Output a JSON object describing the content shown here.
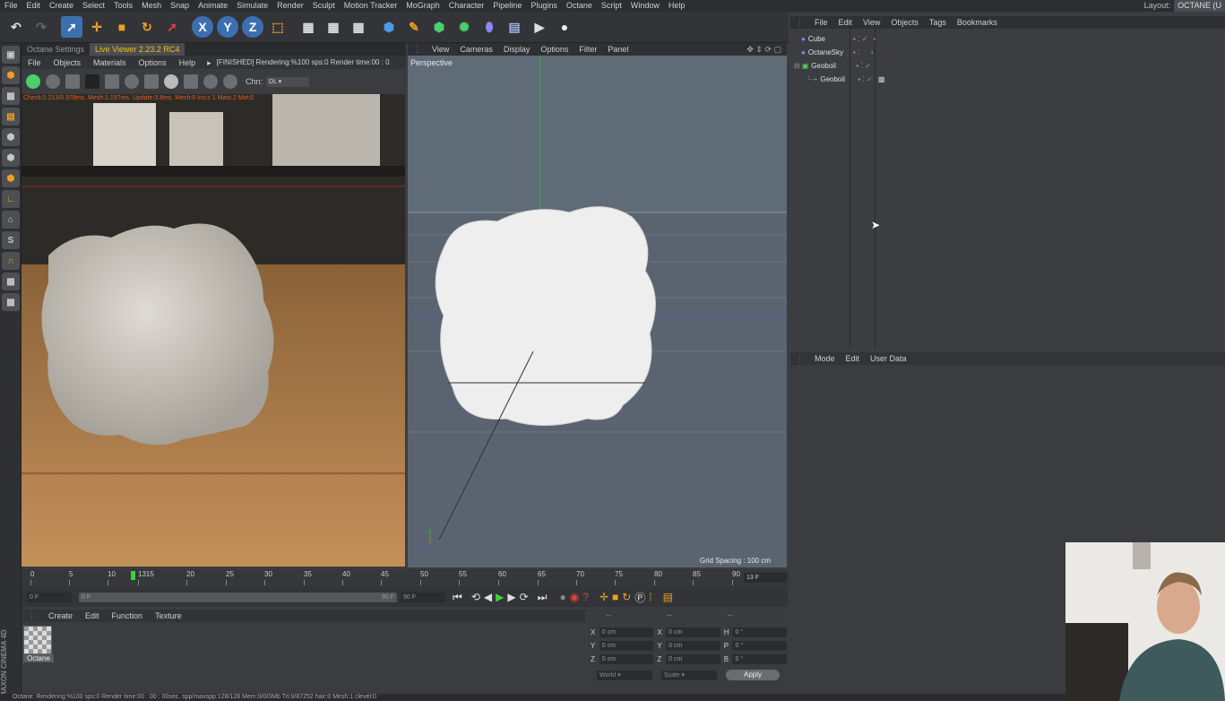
{
  "menu": [
    "File",
    "Edit",
    "Create",
    "Select",
    "Tools",
    "Mesh",
    "Snap",
    "Animate",
    "Simulate",
    "Render",
    "Sculpt",
    "Motion Tracker",
    "MoGraph",
    "Character",
    "Pipeline",
    "Plugins",
    "Octane",
    "Script",
    "Window",
    "Help"
  ],
  "layout": {
    "label": "Layout:",
    "value": "OCTANE (U"
  },
  "octane_tabs": {
    "settings": "Octane Settings",
    "live_viewer": "Live Viewer 2.23.2 RC4"
  },
  "lv_menu": [
    "File",
    "Objects",
    "Materials",
    "Options",
    "Help"
  ],
  "lv_status": "[FINISHED] Rendering:%100 sps:0 Render time:00 : 0",
  "lv_chn_label": "Chn:",
  "lv_chn_value": "DL",
  "lv_info": "Check:0.213/0.978ms. Mesh:1.197ms. Update:3.8ms. Mesh:0 Ins:c 1 Mats:2 Mot:0",
  "vp_menu": [
    "View",
    "Cameras",
    "Display",
    "Options",
    "Filter",
    "Panel"
  ],
  "vp_label": "Perspective",
  "vp_grid": "Grid Spacing : 100 cm",
  "obj_menu": [
    "File",
    "Edit",
    "View",
    "Objects",
    "Tags",
    "Bookmarks"
  ],
  "objects": [
    {
      "name": "Cube",
      "color": "#6a9ae0"
    },
    {
      "name": "OctaneSky",
      "color": "#6a9ae0"
    },
    {
      "name": "Geoboil",
      "color": "#5ad06a"
    },
    {
      "name": "Geoboil",
      "color": "#8ab0c0"
    }
  ],
  "attr_menu": [
    "Mode",
    "Edit",
    "User Data"
  ],
  "timeline_ticks": [
    "0",
    "5",
    "10",
    "1315",
    "20",
    "25",
    "30",
    "35",
    "40",
    "45",
    "50",
    "55",
    "60",
    "65",
    "70",
    "75",
    "80",
    "85",
    "90"
  ],
  "timeline_frame": "13 F",
  "ctrl": {
    "start": "0 F",
    "range_start": "0 F",
    "range_end": "90 F",
    "end": "90 F"
  },
  "mat_menu": [
    "Create",
    "Edit",
    "Function",
    "Texture"
  ],
  "material": "Octane",
  "coords": {
    "header": [
      "--",
      "--",
      "--"
    ],
    "rows": [
      {
        "a": "X",
        "av": "0 cm",
        "b": "X",
        "bv": "0 cm",
        "c": "H",
        "cv": "0 °"
      },
      {
        "a": "Y",
        "av": "0 cm",
        "b": "Y",
        "bv": "0 cm",
        "c": "P",
        "cv": "0 °"
      },
      {
        "a": "Z",
        "av": "0 cm",
        "b": "Z",
        "bv": "0 cm",
        "c": "B",
        "cv": "0 °"
      }
    ],
    "world": "World",
    "scale": "Scale",
    "apply": "Apply"
  },
  "status": "Octane: Rendering:%100 sps:0 Render time:00 : 00 : 00sec. spp/maxspp:128/128 Mem:0/0/0Mb Tri:0/87252 hair:0 Mesh:1 clevel:0",
  "brand": "MAXON CINEMA 4D",
  "colors": {
    "accent": "#f0c020",
    "bg": "#3b3d40",
    "viewport": "#5a6470"
  }
}
